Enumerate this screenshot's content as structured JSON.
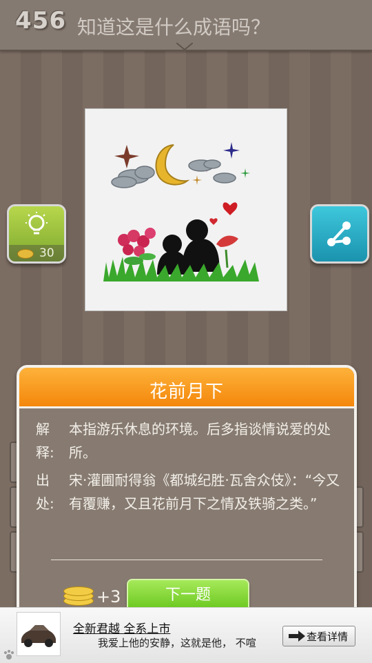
{
  "header": {
    "level": "456",
    "question": "知道这是什么成语吗？"
  },
  "hint": {
    "cost": "30"
  },
  "answer_panel": {
    "title": "花前月下",
    "meaning_label": "解释:",
    "meaning_text": "本指游乐休息的环境。后多指谈情说爱的处所。",
    "source_label": "出处:",
    "source_text": "宋·灌圃耐得翁《都城纪胜·瓦舍众伎》：“今又有覆赚，又且花前月下之情及铁骑之类。”",
    "reward": "+3",
    "next_label": "下一题"
  },
  "ad": {
    "title": "全新君越 全系上市",
    "subtitle": "我爱上他的安静，这就是他， 不喧",
    "button": "查看详情"
  },
  "colors": {
    "header_orange": "#f4870b",
    "next_green": "#68c61d",
    "hint_green": "#9cc23f",
    "share_blue": "#22a9c2"
  }
}
